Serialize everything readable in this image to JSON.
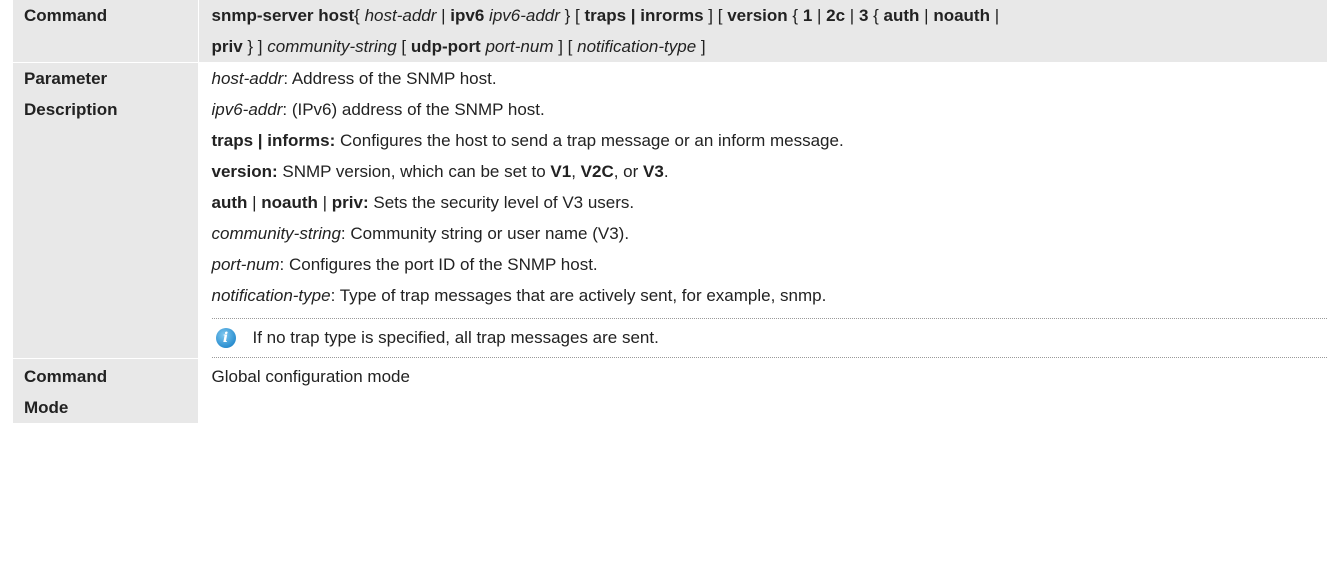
{
  "command_row": {
    "label": "Command",
    "line1": [
      {
        "t": "snmp-server host",
        "s": "b"
      },
      {
        "t": "{ ",
        "s": ""
      },
      {
        "t": "host-addr",
        "s": "i"
      },
      {
        "t": " | ",
        "s": ""
      },
      {
        "t": "ipv6",
        "s": "b"
      },
      {
        "t": " ",
        "s": ""
      },
      {
        "t": "ipv6-addr",
        "s": "i"
      },
      {
        "t": " } [ ",
        "s": ""
      },
      {
        "t": "traps | inrorms",
        "s": "b"
      },
      {
        "t": " ] [ ",
        "s": ""
      },
      {
        "t": "version",
        "s": "b"
      },
      {
        "t": " { ",
        "s": ""
      },
      {
        "t": "1",
        "s": "b"
      },
      {
        "t": " | ",
        "s": ""
      },
      {
        "t": "2c",
        "s": "b"
      },
      {
        "t": " | ",
        "s": ""
      },
      {
        "t": "3",
        "s": "b"
      },
      {
        "t": " { ",
        "s": ""
      },
      {
        "t": "auth",
        "s": "b"
      },
      {
        "t": " | ",
        "s": ""
      },
      {
        "t": "noauth",
        "s": "b"
      },
      {
        "t": " |",
        "s": ""
      }
    ],
    "line2": [
      {
        "t": "priv",
        "s": "b"
      },
      {
        "t": " } ] ",
        "s": ""
      },
      {
        "t": "community-string",
        "s": "i"
      },
      {
        "t": " [ ",
        "s": ""
      },
      {
        "t": "udp-port",
        "s": "b"
      },
      {
        "t": " ",
        "s": ""
      },
      {
        "t": "port-num",
        "s": "i"
      },
      {
        "t": " ] [ ",
        "s": ""
      },
      {
        "t": "notification-type",
        "s": "i"
      },
      {
        "t": " ]",
        "s": ""
      }
    ]
  },
  "parameter_row": {
    "label_line1": "Parameter",
    "label_line2": "Description",
    "lines": [
      [
        {
          "t": "host-addr",
          "s": "i"
        },
        {
          "t": ": Address of the SNMP host.",
          "s": ""
        }
      ],
      [
        {
          "t": "ipv6-addr",
          "s": "i"
        },
        {
          "t": ": (IPv6) address of the SNMP host.",
          "s": ""
        }
      ],
      [
        {
          "t": "traps | informs:",
          "s": "b"
        },
        {
          "t": " Configures the host to send a trap message or an inform message.",
          "s": ""
        }
      ],
      [
        {
          "t": "version:",
          "s": "b"
        },
        {
          "t": " SNMP version, which can be set to ",
          "s": ""
        },
        {
          "t": "V1",
          "s": "b"
        },
        {
          "t": ", ",
          "s": ""
        },
        {
          "t": "V2C",
          "s": "b"
        },
        {
          "t": ", or ",
          "s": ""
        },
        {
          "t": "V3",
          "s": "b"
        },
        {
          "t": ".",
          "s": ""
        }
      ],
      [
        {
          "t": "auth",
          "s": "b"
        },
        {
          "t": " | ",
          "s": ""
        },
        {
          "t": "noauth",
          "s": "b"
        },
        {
          "t": " | ",
          "s": ""
        },
        {
          "t": "priv:",
          "s": "b"
        },
        {
          "t": " Sets the security level of V3 users.",
          "s": ""
        }
      ],
      [
        {
          "t": "community-string",
          "s": "i"
        },
        {
          "t": ": Community string or user name (V3).",
          "s": ""
        }
      ],
      [
        {
          "t": "port-num",
          "s": "i"
        },
        {
          "t": ": Configures the port ID of the SNMP host.",
          "s": ""
        }
      ],
      [
        {
          "t": "notification-type",
          "s": "i"
        },
        {
          "t": ": Type of trap messages that are actively sent, for example, snmp.",
          "s": ""
        }
      ]
    ],
    "note": {
      "icon": "info-icon",
      "text": "If no trap type is specified, all trap messages are sent."
    }
  },
  "mode_row": {
    "label_line1": "Command",
    "label_line2": "Mode",
    "value": "Global configuration mode"
  },
  "colors": {
    "shade": "#e8e8e8",
    "note_icon": "#2c8fd0"
  }
}
